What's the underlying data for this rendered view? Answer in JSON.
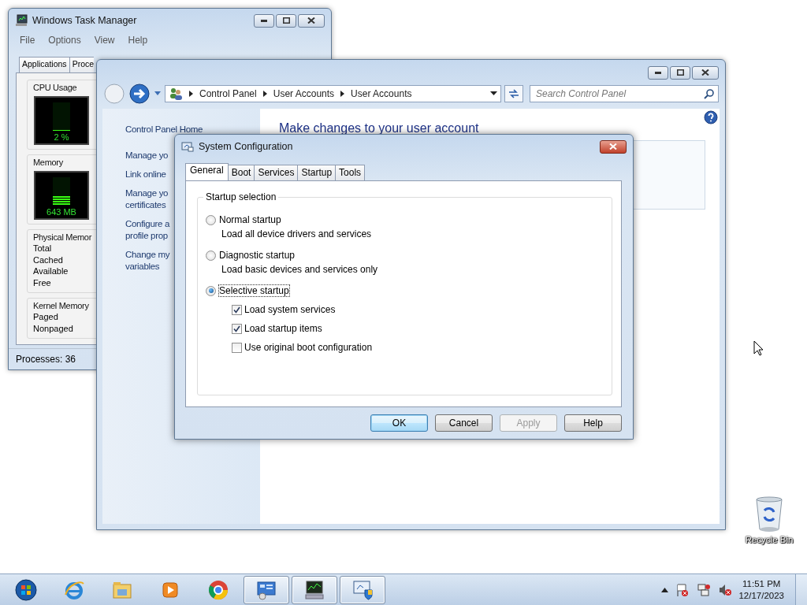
{
  "task_manager": {
    "title": "Windows Task Manager",
    "menu": [
      "File",
      "Options",
      "View",
      "Help"
    ],
    "tabs": [
      {
        "label": "Applications",
        "selected": false
      },
      {
        "label": "Proce",
        "selected": false
      }
    ],
    "cpu": {
      "label": "CPU Usage",
      "reading": "2 %",
      "level": 0.02
    },
    "memory": {
      "label": "Memory",
      "reading": "643 MB",
      "level": 0.32
    },
    "physical_memory": {
      "label": "Physical Memor",
      "rows": [
        "Total",
        "Cached",
        "Available",
        "Free"
      ]
    },
    "kernel_memory": {
      "label": "Kernel Memory",
      "rows": [
        "Paged",
        "Nonpaged"
      ]
    },
    "status_bar": "Processes: 36"
  },
  "control_panel": {
    "breadcrumb": [
      "Control Panel",
      "User Accounts",
      "User Accounts"
    ],
    "search": {
      "placeholder": "Search Control Panel"
    },
    "sidebar": [
      {
        "lines": [
          "Control Panel Home"
        ]
      },
      {
        "lines": [
          "Manage yo"
        ]
      },
      {
        "lines": [
          "Link online"
        ]
      },
      {
        "lines": [
          "Manage yo",
          "certificates"
        ]
      },
      {
        "lines": [
          "Configure a",
          "profile prop"
        ]
      },
      {
        "lines": [
          "Change my",
          "variables"
        ]
      }
    ],
    "heading": "Make changes to your user account"
  },
  "system_configuration": {
    "title": "System Configuration",
    "tabs": [
      {
        "label": "General",
        "selected": true
      },
      {
        "label": "Boot",
        "selected": false
      },
      {
        "label": "Services",
        "selected": false
      },
      {
        "label": "Startup",
        "selected": false
      },
      {
        "label": "Tools",
        "selected": false
      }
    ],
    "group": "Startup selection",
    "options": [
      {
        "label": "Normal startup",
        "description": "Load all device drivers and services",
        "selected": false
      },
      {
        "label": "Diagnostic startup",
        "description": "Load basic devices and services only",
        "selected": false
      },
      {
        "label": "Selective startup",
        "selected": true
      }
    ],
    "checkboxes": [
      {
        "label": "Load system services",
        "checked": true
      },
      {
        "label": "Load startup items",
        "checked": true
      },
      {
        "label": "Use original boot configuration",
        "checked": false
      }
    ],
    "buttons": [
      {
        "label": "OK",
        "default": true,
        "disabled": false
      },
      {
        "label": "Cancel",
        "default": false,
        "disabled": false
      },
      {
        "label": "Apply",
        "default": false,
        "disabled": true
      },
      {
        "label": "Help",
        "default": false,
        "disabled": false
      }
    ]
  },
  "desktop_icons": [
    {
      "label": "Recycle Bin"
    }
  ],
  "taskbar": {
    "items": [
      {
        "kind": "start",
        "open": false
      },
      {
        "kind": "browser",
        "open": false
      },
      {
        "kind": "folder",
        "open": false
      },
      {
        "kind": "media",
        "open": false
      },
      {
        "kind": "chrome",
        "open": false
      },
      {
        "kind": "control-panel",
        "open": true
      },
      {
        "kind": "monitor",
        "open": true
      },
      {
        "kind": "settings",
        "open": true
      }
    ],
    "time": "11:51 PM",
    "date": "12/17/2023"
  }
}
